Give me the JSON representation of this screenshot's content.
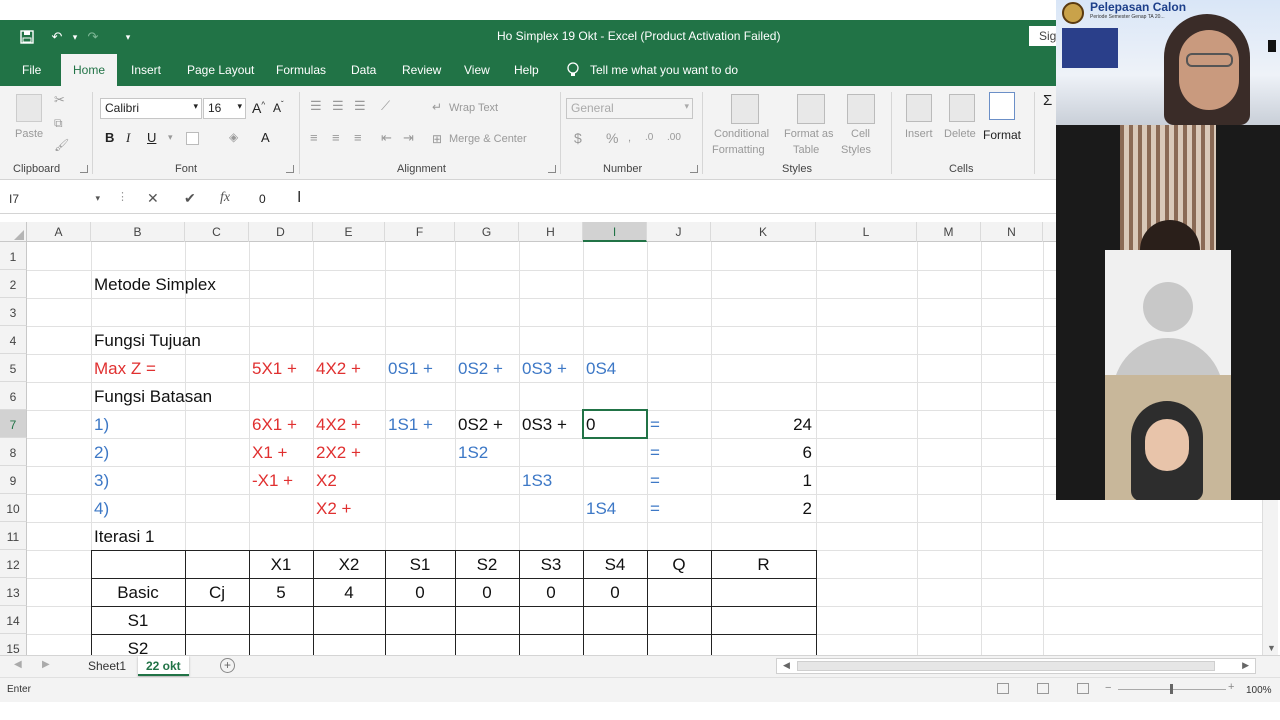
{
  "window": {
    "title": "Ho Simplex 19 Okt  -  Excel (Product Activation Failed)",
    "signin": "Sig"
  },
  "tabs": [
    "File",
    "Home",
    "Insert",
    "Page Layout",
    "Formulas",
    "Data",
    "Review",
    "View",
    "Help"
  ],
  "active_tab": "Home",
  "tell_me": "Tell me what you want to do",
  "ribbon": {
    "clipboard": {
      "label": "Clipboard",
      "paste": "Paste"
    },
    "font": {
      "label": "Font",
      "name": "Calibri",
      "size": "16",
      "bold": "B",
      "italic": "I",
      "underline": "U"
    },
    "alignment": {
      "label": "Alignment",
      "wrap": "Wrap Text",
      "merge": "Merge & Center"
    },
    "number": {
      "label": "Number",
      "format": "General",
      "currency": "$",
      "percent": "%"
    },
    "styles": {
      "label": "Styles",
      "conditional": "Conditional",
      "conditional2": "Formatting",
      "format_as": "Format as",
      "format_as2": "Table",
      "cell": "Cell",
      "cell2": "Styles"
    },
    "cells": {
      "label": "Cells",
      "insert": "Insert",
      "delete": "Delete",
      "format": "Format"
    }
  },
  "formula_bar": {
    "name_box": "I7",
    "value": "0"
  },
  "columns": [
    "A",
    "B",
    "C",
    "D",
    "E",
    "F",
    "G",
    "H",
    "I",
    "J",
    "K",
    "L",
    "M",
    "N"
  ],
  "selected_column": "I",
  "rows": [
    "1",
    "2",
    "3",
    "4",
    "5",
    "6",
    "7",
    "8",
    "9",
    "10",
    "11",
    "12",
    "13",
    "14",
    "15"
  ],
  "selected_row": "7",
  "cells": {
    "b2": "Metode Simplex",
    "b4": "Fungsi Tujuan",
    "b5": "Max Z =",
    "d5": "5X1 +",
    "e5": "4X2 +",
    "f5": "0S1 +",
    "g5": "0S2 +",
    "h5": "0S3 +",
    "i5": "0S4",
    "b6": "Fungsi Batasan",
    "b7": "1)",
    "d7": "6X1 +",
    "e7": "4X2 +",
    "f7": "1S1 +",
    "g7": "0S2 +",
    "h7": "0S3 +",
    "i7": "0",
    "j7": "=",
    "k7": "24",
    "b8": "2)",
    "d8": "X1 +",
    "e8": "2X2 +",
    "g8": "1S2",
    "j8": "=",
    "k8": "6",
    "b9": "3)",
    "d9": "-X1 +",
    "e9": "X2",
    "h9": "1S3",
    "j9": "=",
    "k9": "1",
    "b10": "4)",
    "e10": "X2 +",
    "i10": "1S4",
    "j10": "=",
    "k10": "2",
    "b11": "Iterasi 1",
    "d12": "X1",
    "e12": "X2",
    "f12": "S1",
    "g12": "S2",
    "h12": "S3",
    "i12": "S4",
    "j12": "Q",
    "k12": "R",
    "b13": "Basic",
    "c13": "Cj",
    "d13": "5",
    "e13": "4",
    "f13": "0",
    "g13": "0",
    "h13": "0",
    "i13": "0",
    "b14": "S1",
    "b15": "S2"
  },
  "sheets": [
    "Sheet1",
    "22 okt"
  ],
  "active_sheet": "22 okt",
  "status": {
    "mode": "Enter",
    "zoom": "100%"
  },
  "video": {
    "banner": "Pelepasan Calon",
    "banner_sub": "Periode Semester Genap TA 20..."
  },
  "colors": {
    "excel_green": "#217346",
    "red_text": "#e03030",
    "blue_text": "#3d78c6"
  }
}
